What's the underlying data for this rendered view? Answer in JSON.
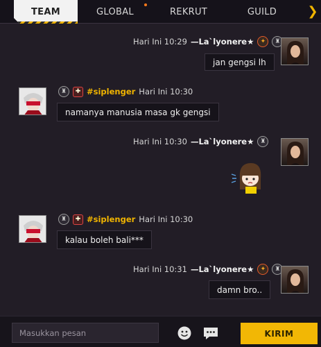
{
  "tabs": [
    {
      "label": "TEAM",
      "active": true
    },
    {
      "label": "GLOBAL",
      "active": false
    },
    {
      "label": "REKRUT",
      "active": false
    },
    {
      "label": "GUILD",
      "active": false
    }
  ],
  "messages": [
    {
      "side": "right",
      "time": "Hari Ini 10:29",
      "sender": "—La`lyonere★",
      "text": "jan gengsi lh"
    },
    {
      "side": "left",
      "time": "Hari Ini 10:30",
      "sender": "#siplenger",
      "text": "namanya manusia masa gk gengsi"
    },
    {
      "side": "right",
      "time": "Hari Ini 10:30",
      "sender": "—La`lyonere★",
      "sticker": "chibi-girl-sticker"
    },
    {
      "side": "left",
      "time": "Hari Ini 10:30",
      "sender": "#siplenger",
      "text": "kalau boleh bali***"
    },
    {
      "side": "right",
      "time": "Hari Ini 10:31",
      "sender": "—La`lyonere★",
      "text": "damn bro.."
    }
  ],
  "composer": {
    "placeholder": "Masukkan pesan",
    "send_label": "KIRIM",
    "emoji_icon": "emoji-icon",
    "quick_chat_icon": "quick-chat-icon"
  },
  "colors": {
    "accent": "#f2b705",
    "background": "#221d26",
    "bubble": "#16131a"
  }
}
